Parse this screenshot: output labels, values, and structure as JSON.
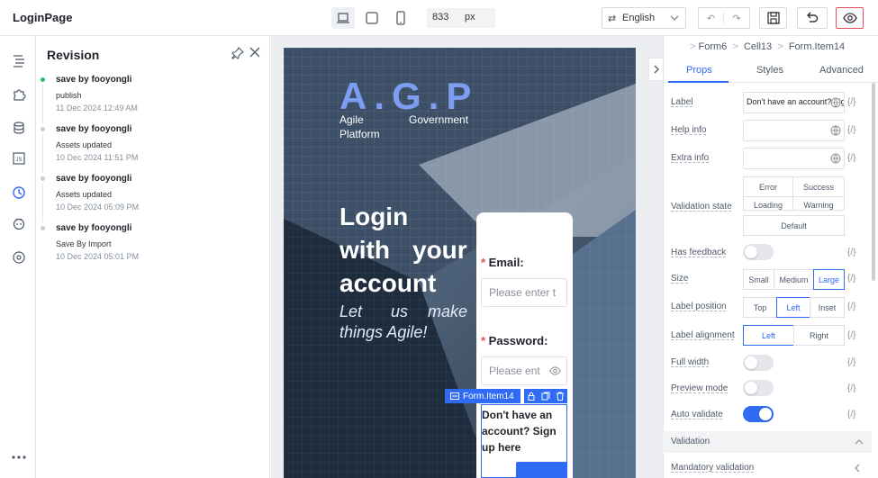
{
  "app": {
    "title": "LoginPage"
  },
  "toolbar": {
    "width_value": "833",
    "width_unit": "px",
    "language": "English"
  },
  "revision": {
    "title": "Revision",
    "items": [
      {
        "name": "save by fooyongli",
        "desc": "publish",
        "time": "11 Dec 2024 12:49 AM",
        "active": true
      },
      {
        "name": "save by fooyongli",
        "desc": "Assets updated",
        "time": "10 Dec 2024 11:51 PM"
      },
      {
        "name": "save by fooyongli",
        "desc": "Assets updated",
        "time": "10 Dec 2024 05:09 PM"
      },
      {
        "name": "save by fooyongli",
        "desc": "Save By Import",
        "time": "10 Dec 2024 05:01 PM"
      }
    ]
  },
  "page": {
    "logo": "A.G.P",
    "tagline_1": "Agile",
    "tagline_2": "Government",
    "tagline_3": "Platform",
    "heading_1": "Login",
    "heading_2a": "with",
    "heading_2b": "your",
    "heading_3": "account",
    "sub_1a": "Let",
    "sub_1b": "us",
    "sub_1c": "make",
    "sub_2": "things Agile!",
    "email_label": "Email:",
    "email_placeholder": "Please enter t",
    "password_label": "Password:",
    "password_placeholder": "Please ent",
    "selected_tag": "Form.Item14",
    "signup_text": "Don't have an account? Sign up here"
  },
  "props": {
    "breadcrumb": [
      "Form6",
      "Cell13",
      "Form.Item14"
    ],
    "tabs": [
      "Props",
      "Styles",
      "Advanced"
    ],
    "braces": "{/}",
    "label": {
      "label": "Label",
      "value": "Don't have an account? Sign"
    },
    "help_info": {
      "label": "Help info"
    },
    "extra_info": {
      "label": "Extra info"
    },
    "validation_state": {
      "label": "Validation state",
      "options": [
        "Error",
        "Success",
        "Loading",
        "Warning",
        "Default"
      ]
    },
    "has_feedback": {
      "label": "Has feedback",
      "on": false
    },
    "size": {
      "label": "Size",
      "options": [
        "Small",
        "Medium",
        "Large"
      ],
      "selected": "Large"
    },
    "label_position": {
      "label": "Label position",
      "options": [
        "Top",
        "Left",
        "Inset"
      ],
      "selected": "Left"
    },
    "label_alignment": {
      "label": "Label alignment",
      "options": [
        "Left",
        "Right"
      ],
      "selected": "Left"
    },
    "full_width": {
      "label": "Full width",
      "on": false
    },
    "preview_mode": {
      "label": "Preview mode",
      "on": false
    },
    "auto_validate": {
      "label": "Auto validate",
      "on": true
    },
    "validation_section": "Validation",
    "mandatory_validation": "Mandatory validation"
  },
  "colors": {
    "accent": "#2f6bf5",
    "danger": "#e34d59",
    "active_dot": "#22c55e"
  }
}
